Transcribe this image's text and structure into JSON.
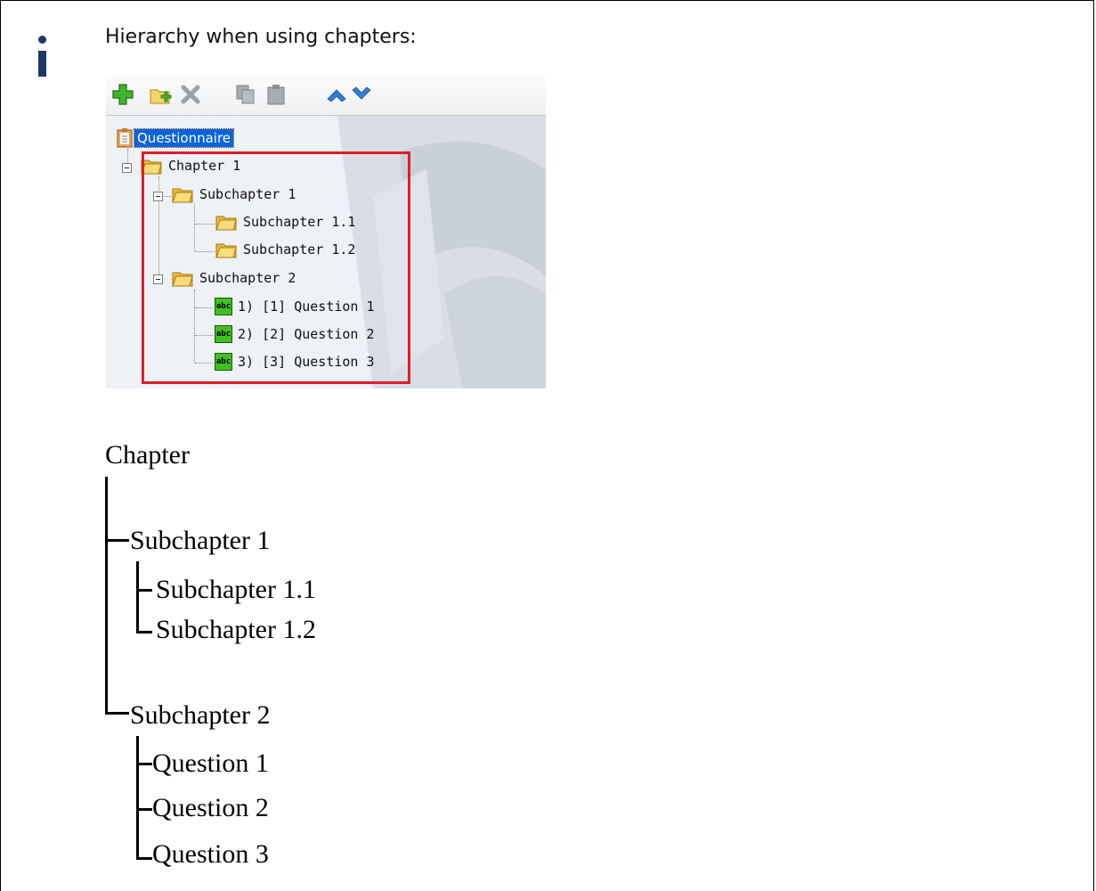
{
  "note": {
    "icon": "info-icon",
    "heading": "Hierarchy when using chapters:"
  },
  "screenshot": {
    "toolbar": [
      {
        "icon": "add-icon"
      },
      {
        "icon": "add-chapter-icon"
      },
      {
        "icon": "delete-icon"
      },
      {
        "icon": "copy-icon"
      },
      {
        "icon": "paste-icon"
      },
      {
        "icon": "move-up-icon"
      },
      {
        "icon": "move-down-icon"
      }
    ],
    "tree": {
      "root": "Questionnaire",
      "chapter": "Chapter 1",
      "sub1": "Subchapter 1",
      "sub11": "Subchapter 1.1",
      "sub12": "Subchapter 1.2",
      "sub2": "Subchapter 2",
      "q1": "1) [1] Question 1",
      "q2": "2) [2] Question 2",
      "q3": "3) [3] Question 3",
      "question_icon_text": "abc"
    },
    "highlight_color": "#e11d27",
    "selection_color": "#0a64d8"
  },
  "hierarchy": {
    "chapter": "Chapter",
    "sub1": "Subchapter 1",
    "sub11": "Subchapter 1.1",
    "sub12": "Subchapter 1.2",
    "sub2": "Subchapter 2",
    "q1": "Question 1",
    "q2": "Question 2",
    "q3": "Question 3"
  }
}
